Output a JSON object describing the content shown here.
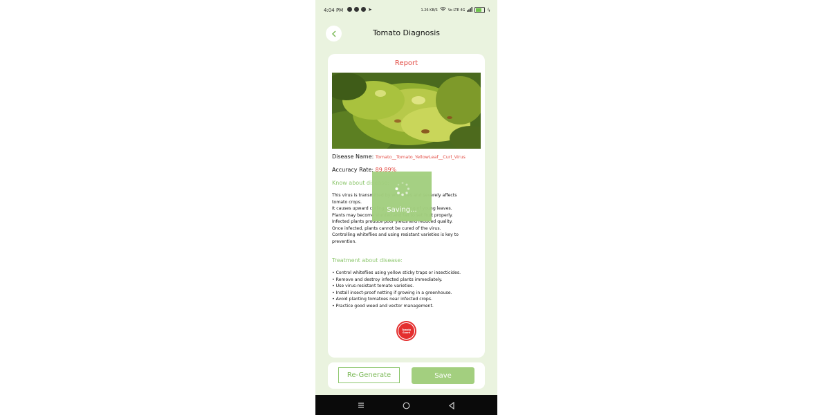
{
  "status_bar": {
    "time": "4:04 PM",
    "app_icons": [
      "whatsapp-icon",
      "youtube-icon",
      "camera-icon",
      "telegram-icon"
    ],
    "right_text": "1.26 KB/S",
    "network": "Vo LTE 4G"
  },
  "header": {
    "title": "Tomato Diagnosis"
  },
  "report": {
    "title": "Report",
    "disease_label": "Disease Name:",
    "disease_value": "Tomato__Tomato_YellowLeaf__Curl_Virus",
    "accuracy_label": "Accuracy Rate:",
    "accuracy_value": "89.89%",
    "know_heading": "Know about disease:",
    "description": [
      "This virus is transmitted by whiteflies and severely affects",
      "tomato crops.",
      "It causes upward curling and yellowing of young leaves.",
      "Plants may become stunted and fail to set fruit properly.",
      "Infected plants produce poor yields and reduced quality.",
      "Once infected, plants cannot be cured of the virus.",
      "Controlling whiteflies and using resistant varieties is key to",
      "prevention."
    ],
    "treatment_heading": "Treatment about disease:",
    "treatment": [
      "• Control whiteflies using yellow sticky traps or insecticides.",
      "• Remove and destroy infected plants immediately.",
      "• Use virus-resistant tomato varieties.",
      "• Install insect-proof netting if growing in a greenhouse.",
      "• Avoid planting tomatoes near infected crops.",
      "• Practice good weed and vector management."
    ],
    "logo_line1": "Tomato",
    "logo_line2": "Guard"
  },
  "overlay": {
    "text": "Saving..."
  },
  "actions": {
    "regenerate_label": "Re-Generate",
    "save_label": "Save"
  },
  "colors": {
    "accent_green": "#a3cf7f",
    "accent_red": "#e24b43",
    "background": "#eaf3df"
  }
}
